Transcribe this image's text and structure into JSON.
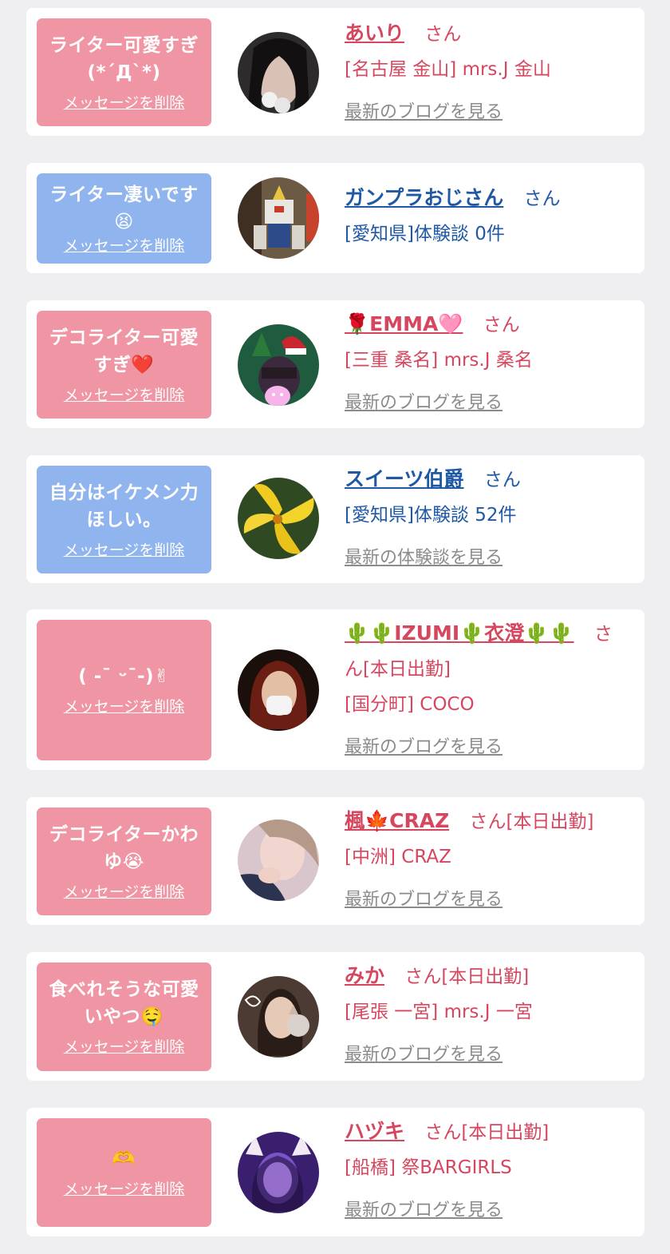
{
  "entries": [
    {
      "message": "ライター可愛すぎ(*´Д`*)",
      "delete_label": "メッセージを削除",
      "name": "あいり",
      "honorific": "さん",
      "shop": "[名古屋 金山] mrs.J 金山",
      "link": "最新のブログを見る",
      "theme": "pink"
    },
    {
      "message": "ライター凄いです😫",
      "delete_label": "メッセージを削除",
      "name": "ガンプラおじさん",
      "honorific": "さん",
      "shop": "[愛知県]体験談 0件",
      "link": "",
      "theme": "blue"
    },
    {
      "message": "デコライター可愛すぎ❤️",
      "delete_label": "メッセージを削除",
      "name": "🌹EMMA🩷",
      "honorific": "さん",
      "shop": "[三重 桑名] mrs.J 桑名",
      "link": "最新のブログを見る",
      "theme": "pink"
    },
    {
      "message": "自分はイケメン力ほしい。",
      "delete_label": "メッセージを削除",
      "name": "スイーツ伯爵",
      "honorific": "さん",
      "shop": "[愛知県]体験談 52件",
      "link": "最新の体験談を見る",
      "theme": "blue"
    },
    {
      "message": "( -ˉ ᵕˉ-)✌",
      "delete_label": "メッセージを削除",
      "name": "🌵🌵IZUMI🌵衣澄🌵🌵",
      "honorific": "さ",
      "honorific_cont": "ん[本日出勤]",
      "shop": "[国分町] COCO",
      "link": "最新のブログを見る",
      "theme": "pink"
    },
    {
      "message": "デコライターかわゆ😭",
      "delete_label": "メッセージを削除",
      "name": "楓🍁CRAZ",
      "honorific": "さん[本日出勤]",
      "shop": "[中洲] CRAZ",
      "link": "最新のブログを見る",
      "theme": "pink"
    },
    {
      "message": "食べれそうな可愛いやつ🤤",
      "delete_label": "メッセージを削除",
      "name": "みか",
      "honorific": "さん[本日出勤]",
      "shop": "[尾張 一宮] mrs.J 一宮",
      "link": "最新のブログを見る",
      "theme": "pink"
    },
    {
      "message": "🫶",
      "delete_label": "メッセージを削除",
      "name": "ハヅキ",
      "honorific": "さん[本日出勤]",
      "shop": "[船橋] 祭BARGIRLS",
      "link": "最新のブログを見る",
      "theme": "pink"
    }
  ],
  "colors": {
    "page_bg": "#efeff1",
    "pink_bubble": "#ef95a3",
    "blue_bubble": "#8fb4ee",
    "pink_text": "#d6475f",
    "blue_text": "#1f58a5",
    "link_gray": "#8b8b8b"
  }
}
